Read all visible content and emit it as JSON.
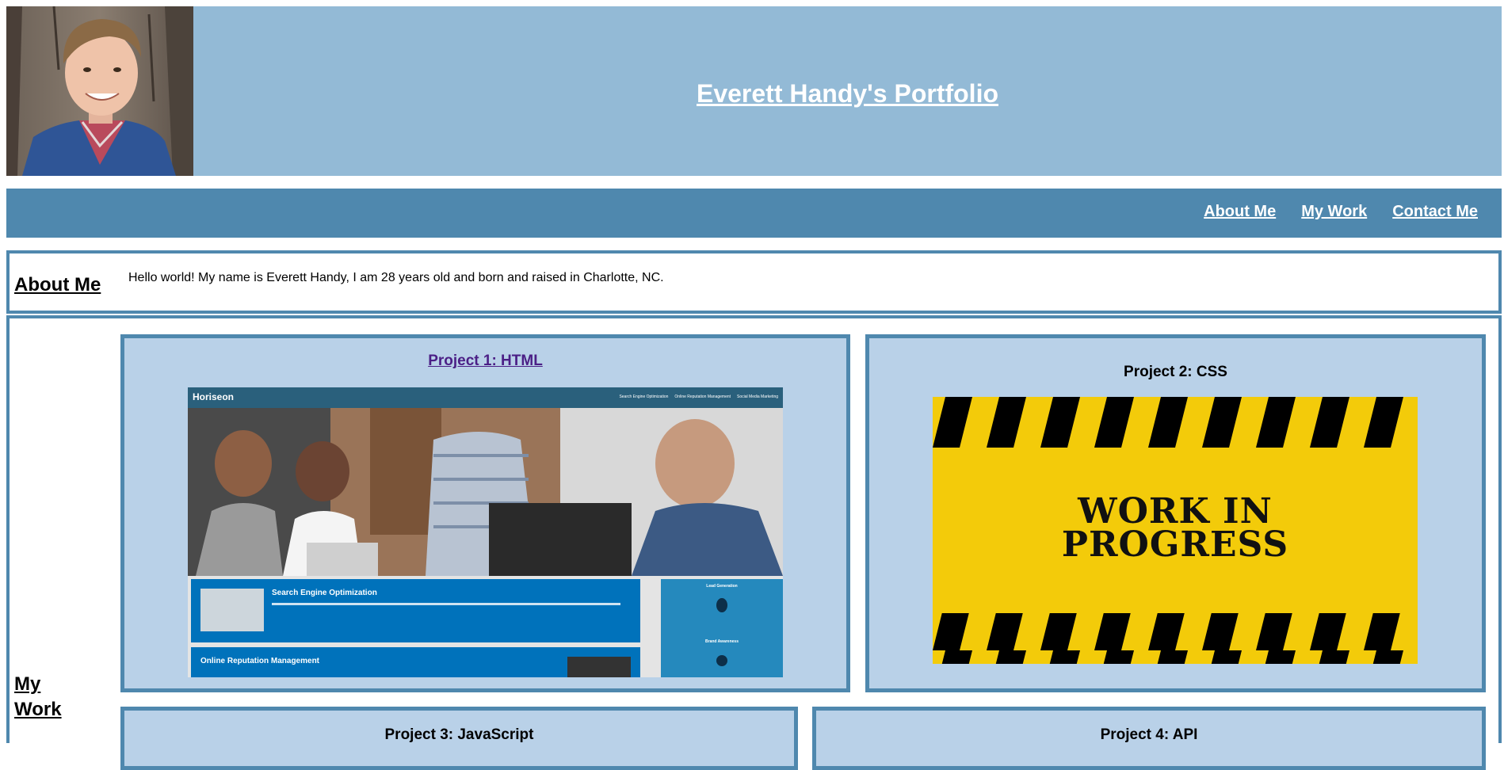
{
  "header": {
    "title": "Everett Handy's Portfolio"
  },
  "nav": {
    "items": [
      {
        "label": "About Me"
      },
      {
        "label": "My Work"
      },
      {
        "label": "Contact Me"
      }
    ]
  },
  "about": {
    "heading": "About Me",
    "text": "Hello world! My name is Everett Handy, I am 28 years old and born and raised in Charlotte, NC."
  },
  "work": {
    "heading_line1": "My",
    "heading_line2": "Work",
    "projects": [
      {
        "title": "Project 1: HTML",
        "screenshot": {
          "brand": "Hori",
          "brand_bold": "seon",
          "nav": [
            "Search Engine Optimization",
            "Online Reputation Management",
            "Social Media Marketing"
          ],
          "card1_title": "Search Engine Optimization",
          "card2_title": "Online Reputation Management",
          "side1_title": "Lead Generation",
          "side2_title": "Brand Awareness"
        }
      },
      {
        "title": "Project 2: CSS",
        "image_text_line1": "WORK IN",
        "image_text_line2": "PROGRESS"
      },
      {
        "title": "Project 3: JavaScript"
      },
      {
        "title": "Project 4: API"
      }
    ]
  },
  "colors": {
    "header_bg": "#93bad6",
    "nav_bg": "#4f88ae",
    "card_bg": "#b9d1e8",
    "border": "#4f88ae",
    "link_visited": "#4b1f86",
    "caution_yellow": "#f3cb0a"
  }
}
